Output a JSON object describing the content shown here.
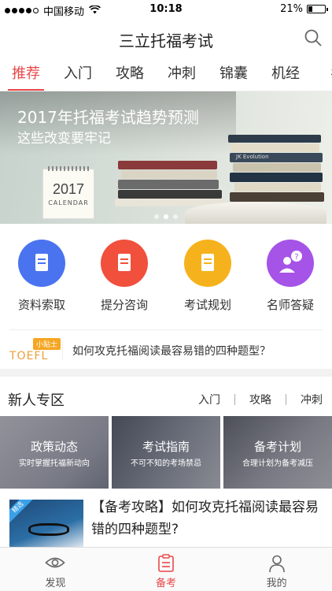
{
  "status_bar": {
    "carrier": "中国移动",
    "time": "10:18",
    "battery": "21%"
  },
  "header": {
    "title": "三立托福考试"
  },
  "tabs": [
    {
      "label": "推荐",
      "active": true
    },
    {
      "label": "入门"
    },
    {
      "label": "攻略"
    },
    {
      "label": "冲刺"
    },
    {
      "label": "锦囊"
    },
    {
      "label": "机经"
    },
    {
      "label": "名"
    }
  ],
  "banner": {
    "line1": "2017年托福考试趋势预测",
    "line2": "这些改变要牢记",
    "calendar_year": "2017",
    "calendar_word": "CALENDAR",
    "book_spine_text": "JK Evolution"
  },
  "quick_actions": [
    {
      "label": "资料索取",
      "color": "#4a73f0",
      "icon": "document-icon"
    },
    {
      "label": "提分咨询",
      "color": "#f0503c",
      "icon": "consult-icon"
    },
    {
      "label": "考试规划",
      "color": "#f5b21c",
      "icon": "plan-icon"
    },
    {
      "label": "名师答疑",
      "color": "#a653e8",
      "icon": "qa-icon"
    }
  ],
  "tips": {
    "badge": "小贴士",
    "brand": "TOEFL",
    "text": "如何攻克托福阅读最容易错的四种题型？"
  },
  "newbie": {
    "title": "新人专区",
    "links": [
      "入门",
      "攻略",
      "冲刺"
    ],
    "cards": [
      {
        "title": "政策动态",
        "subtitle": "实时掌握托福新动向"
      },
      {
        "title": "考试指南",
        "subtitle": "不可不知的考场禁忌"
      },
      {
        "title": "备考计划",
        "subtitle": "合理计划为备考减压"
      }
    ]
  },
  "article": {
    "tag": "精选",
    "title": "【备考攻略】如何攻克托福阅读最容易错的四种题型?"
  },
  "bottom_nav": [
    {
      "label": "发现",
      "icon": "eye-icon"
    },
    {
      "label": "备考",
      "icon": "clipboard-icon",
      "active": true
    },
    {
      "label": "我的",
      "icon": "person-icon"
    }
  ]
}
